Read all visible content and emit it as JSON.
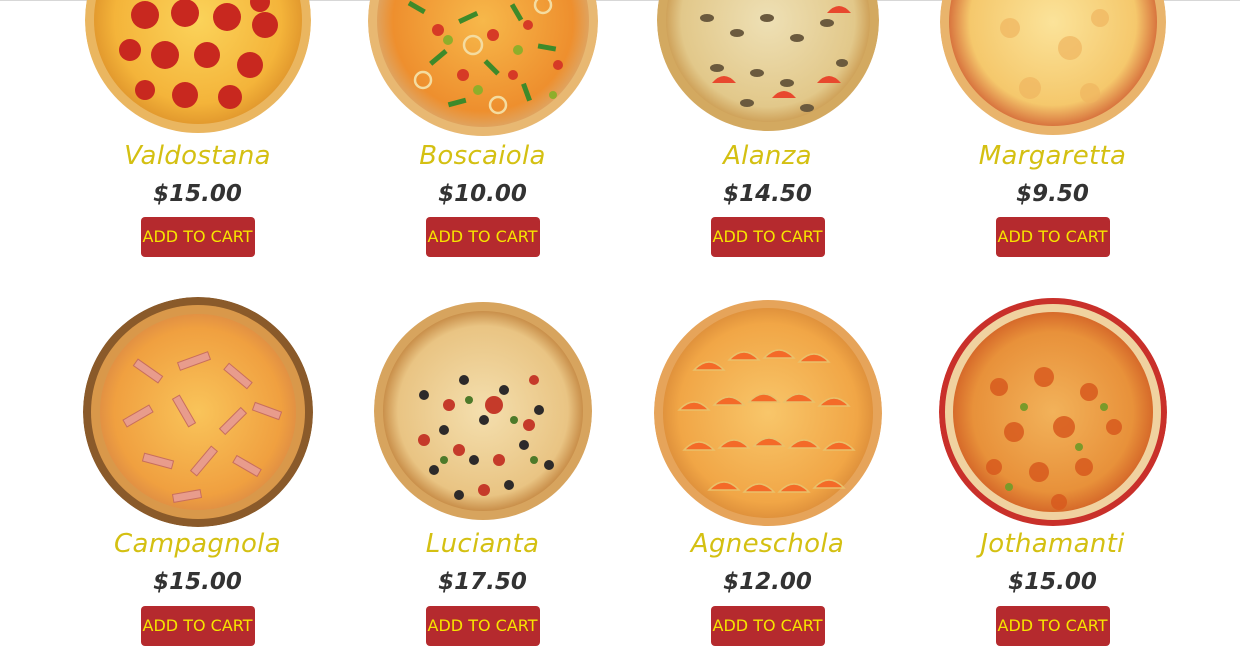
{
  "button_label": "ADD TO CART",
  "colors": {
    "name": "#d4c012",
    "price": "#333333",
    "button_bg": "#b52a2e",
    "button_text": "#f6e400"
  },
  "products": [
    {
      "name": "Valdostana",
      "price": "$15.00",
      "topping": "pepperoni"
    },
    {
      "name": "Boscaiola",
      "price": "$10.00",
      "topping": "vegetable"
    },
    {
      "name": "Alanza",
      "price": "$14.50",
      "topping": "mushroom-tomato"
    },
    {
      "name": "Margaretta",
      "price": "$9.50",
      "topping": "cheese"
    },
    {
      "name": "Campagnola",
      "price": "$15.00",
      "topping": "ham"
    },
    {
      "name": "Lucianta",
      "price": "$17.50",
      "topping": "supreme"
    },
    {
      "name": "Agneschola",
      "price": "$12.00",
      "topping": "tomato"
    },
    {
      "name": "Jothamanti",
      "price": "$15.00",
      "topping": "spicy"
    }
  ]
}
